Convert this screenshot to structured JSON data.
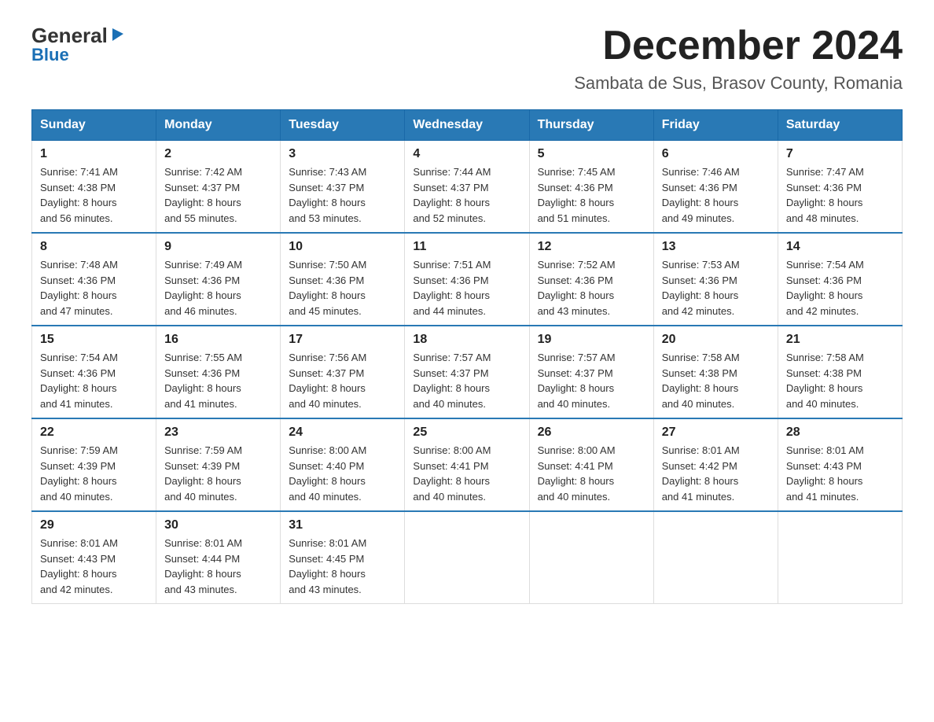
{
  "logo": {
    "general": "General",
    "blue": "Blue",
    "triangle": "▶"
  },
  "title": "December 2024",
  "location": "Sambata de Sus, Brasov County, Romania",
  "weekdays": [
    "Sunday",
    "Monday",
    "Tuesday",
    "Wednesday",
    "Thursday",
    "Friday",
    "Saturday"
  ],
  "weeks": [
    [
      {
        "day": "1",
        "sunrise": "7:41 AM",
        "sunset": "4:38 PM",
        "daylight": "8 hours and 56 minutes."
      },
      {
        "day": "2",
        "sunrise": "7:42 AM",
        "sunset": "4:37 PM",
        "daylight": "8 hours and 55 minutes."
      },
      {
        "day": "3",
        "sunrise": "7:43 AM",
        "sunset": "4:37 PM",
        "daylight": "8 hours and 53 minutes."
      },
      {
        "day": "4",
        "sunrise": "7:44 AM",
        "sunset": "4:37 PM",
        "daylight": "8 hours and 52 minutes."
      },
      {
        "day": "5",
        "sunrise": "7:45 AM",
        "sunset": "4:36 PM",
        "daylight": "8 hours and 51 minutes."
      },
      {
        "day": "6",
        "sunrise": "7:46 AM",
        "sunset": "4:36 PM",
        "daylight": "8 hours and 49 minutes."
      },
      {
        "day": "7",
        "sunrise": "7:47 AM",
        "sunset": "4:36 PM",
        "daylight": "8 hours and 48 minutes."
      }
    ],
    [
      {
        "day": "8",
        "sunrise": "7:48 AM",
        "sunset": "4:36 PM",
        "daylight": "8 hours and 47 minutes."
      },
      {
        "day": "9",
        "sunrise": "7:49 AM",
        "sunset": "4:36 PM",
        "daylight": "8 hours and 46 minutes."
      },
      {
        "day": "10",
        "sunrise": "7:50 AM",
        "sunset": "4:36 PM",
        "daylight": "8 hours and 45 minutes."
      },
      {
        "day": "11",
        "sunrise": "7:51 AM",
        "sunset": "4:36 PM",
        "daylight": "8 hours and 44 minutes."
      },
      {
        "day": "12",
        "sunrise": "7:52 AM",
        "sunset": "4:36 PM",
        "daylight": "8 hours and 43 minutes."
      },
      {
        "day": "13",
        "sunrise": "7:53 AM",
        "sunset": "4:36 PM",
        "daylight": "8 hours and 42 minutes."
      },
      {
        "day": "14",
        "sunrise": "7:54 AM",
        "sunset": "4:36 PM",
        "daylight": "8 hours and 42 minutes."
      }
    ],
    [
      {
        "day": "15",
        "sunrise": "7:54 AM",
        "sunset": "4:36 PM",
        "daylight": "8 hours and 41 minutes."
      },
      {
        "day": "16",
        "sunrise": "7:55 AM",
        "sunset": "4:36 PM",
        "daylight": "8 hours and 41 minutes."
      },
      {
        "day": "17",
        "sunrise": "7:56 AM",
        "sunset": "4:37 PM",
        "daylight": "8 hours and 40 minutes."
      },
      {
        "day": "18",
        "sunrise": "7:57 AM",
        "sunset": "4:37 PM",
        "daylight": "8 hours and 40 minutes."
      },
      {
        "day": "19",
        "sunrise": "7:57 AM",
        "sunset": "4:37 PM",
        "daylight": "8 hours and 40 minutes."
      },
      {
        "day": "20",
        "sunrise": "7:58 AM",
        "sunset": "4:38 PM",
        "daylight": "8 hours and 40 minutes."
      },
      {
        "day": "21",
        "sunrise": "7:58 AM",
        "sunset": "4:38 PM",
        "daylight": "8 hours and 40 minutes."
      }
    ],
    [
      {
        "day": "22",
        "sunrise": "7:59 AM",
        "sunset": "4:39 PM",
        "daylight": "8 hours and 40 minutes."
      },
      {
        "day": "23",
        "sunrise": "7:59 AM",
        "sunset": "4:39 PM",
        "daylight": "8 hours and 40 minutes."
      },
      {
        "day": "24",
        "sunrise": "8:00 AM",
        "sunset": "4:40 PM",
        "daylight": "8 hours and 40 minutes."
      },
      {
        "day": "25",
        "sunrise": "8:00 AM",
        "sunset": "4:41 PM",
        "daylight": "8 hours and 40 minutes."
      },
      {
        "day": "26",
        "sunrise": "8:00 AM",
        "sunset": "4:41 PM",
        "daylight": "8 hours and 40 minutes."
      },
      {
        "day": "27",
        "sunrise": "8:01 AM",
        "sunset": "4:42 PM",
        "daylight": "8 hours and 41 minutes."
      },
      {
        "day": "28",
        "sunrise": "8:01 AM",
        "sunset": "4:43 PM",
        "daylight": "8 hours and 41 minutes."
      }
    ],
    [
      {
        "day": "29",
        "sunrise": "8:01 AM",
        "sunset": "4:43 PM",
        "daylight": "8 hours and 42 minutes."
      },
      {
        "day": "30",
        "sunrise": "8:01 AM",
        "sunset": "4:44 PM",
        "daylight": "8 hours and 43 minutes."
      },
      {
        "day": "31",
        "sunrise": "8:01 AM",
        "sunset": "4:45 PM",
        "daylight": "8 hours and 43 minutes."
      },
      null,
      null,
      null,
      null
    ]
  ],
  "labels": {
    "sunrise": "Sunrise:",
    "sunset": "Sunset:",
    "daylight": "Daylight:"
  }
}
